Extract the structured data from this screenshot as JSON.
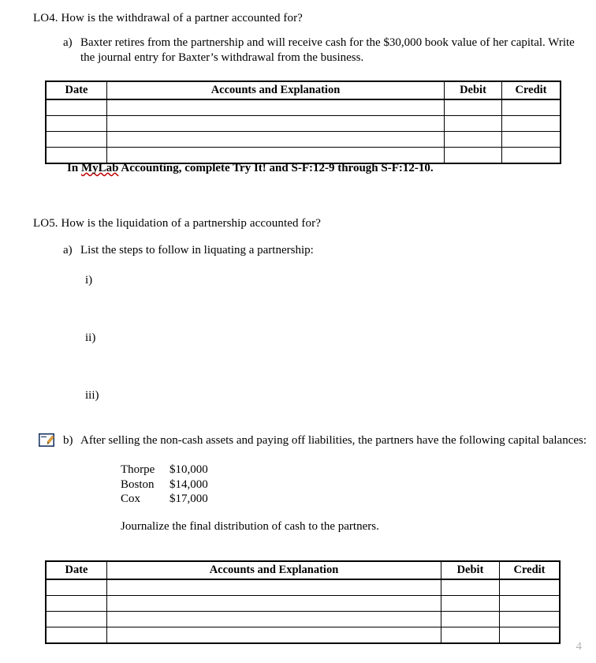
{
  "document": {
    "page_number": "4"
  },
  "sections": [
    {
      "id": "lo4",
      "heading": "LO4. How is the withdrawal of a partner accounted for?",
      "items": [
        {
          "marker": "a)",
          "text": "Baxter retires from the partnership and will receive cash for the $30,000 book value of her capital. Write the journal entry for Baxter’s withdrawal from the business."
        }
      ],
      "note": {
        "prefix": "In ",
        "misspelled_word": "MyLab",
        "suffix": " Accounting, complete Try It! and S-F:12-9 through S-F:12-10."
      }
    },
    {
      "id": "lo5",
      "heading": "LO5. How is the liquidation of a partnership accounted for?",
      "items": [
        {
          "marker": "a)",
          "text": "List the steps to follow in liquating a partnership:"
        },
        {
          "marker": "b)",
          "text": "After selling the non-cash assets and paying off liabilities, the partners have the following capital balances:"
        }
      ],
      "roman_markers": [
        "i)",
        "ii)",
        "iii)"
      ],
      "balances": [
        {
          "name": "Thorpe",
          "amount": "$10,000"
        },
        {
          "name": "Boston",
          "amount": "$14,000"
        },
        {
          "name": "Cox",
          "amount": "$17,000"
        }
      ],
      "instruction": "Journalize the final distribution of cash to the partners."
    }
  ],
  "journal_tables": [
    {
      "id": "journal-table-1",
      "headers": [
        "Date",
        "Accounts and Explanation",
        "Debit",
        "Credit"
      ],
      "rows": [
        [
          "",
          "",
          "",
          ""
        ],
        [
          "",
          "",
          "",
          ""
        ],
        [
          "",
          "",
          "",
          ""
        ],
        [
          "",
          "",
          "",
          ""
        ]
      ]
    },
    {
      "id": "journal-table-2",
      "headers": [
        "Date",
        "Accounts and Explanation",
        "Debit",
        "Credit"
      ],
      "rows": [
        [
          "",
          "",
          "",
          ""
        ],
        [
          "",
          "",
          "",
          ""
        ],
        [
          "",
          "",
          "",
          ""
        ],
        [
          "",
          "",
          "",
          ""
        ]
      ]
    }
  ],
  "icons": {
    "write_icon_name": "write-pencil-icon",
    "write_icon_frame_color": "#1f3864",
    "write_icon_pencil_color": "#e8a33d"
  }
}
